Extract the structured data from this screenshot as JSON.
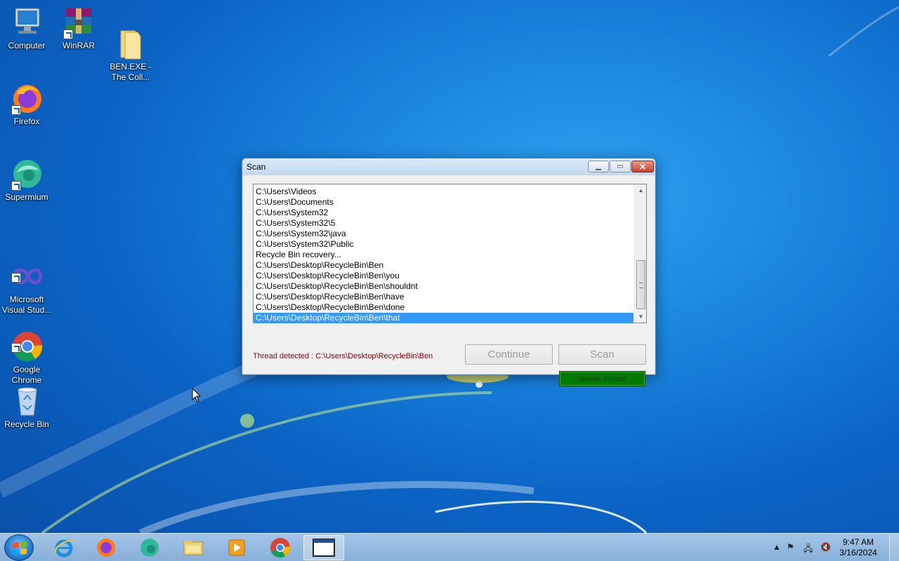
{
  "desktop": {
    "icons": [
      {
        "label": "Computer"
      },
      {
        "label": "WinRAR"
      },
      {
        "label": "BEN.EXE -\nThe Coll..."
      },
      {
        "label": "Firefox"
      },
      {
        "label": "Supermium"
      },
      {
        "label": "Microsoft\nVisual Stud..."
      },
      {
        "label": "Google\nChrome"
      },
      {
        "label": "Recycle Bin"
      }
    ]
  },
  "window": {
    "title": "Scan",
    "list_items": [
      "C:\\Users\\Videos",
      "C:\\Users\\Documents",
      "C:\\Users\\System32",
      "C:\\Users\\System32\\5",
      "C:\\Users\\System32\\java",
      "C:\\Users\\System32\\Public",
      "Recycle Bin recovery...",
      "C:\\Users\\Desktop\\RecycleBin\\Ben",
      "C:\\Users\\Desktop\\RecycleBin\\Ben\\you",
      "C:\\Users\\Desktop\\RecycleBin\\Ben\\shouldnt",
      "C:\\Users\\Desktop\\RecycleBin\\Ben\\have",
      "C:\\Users\\Desktop\\RecycleBin\\Ben\\done",
      "C:\\Users\\Desktop\\RecycleBin\\Ben\\that"
    ],
    "selected_index": 12,
    "thread_label": "Thread detected : C:\\Users\\Desktop\\RecycleBin\\Ben",
    "continue_label": "Continue",
    "scan_label": "Scan",
    "delete_label": "delete thread"
  },
  "taskbar": {
    "time": "9:47 AM",
    "date": "3/16/2024"
  },
  "colors": {
    "selection": "#3399ff",
    "thread_text": "#8b0000",
    "delete_button": "#007a00"
  }
}
